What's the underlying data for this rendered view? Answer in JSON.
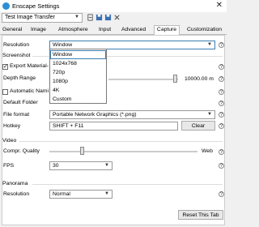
{
  "window": {
    "title": "Enscape Settings",
    "close_glyph": "✕"
  },
  "preset": {
    "value": "Test Image Transfer"
  },
  "tabs": [
    "General",
    "Image",
    "Atmosphere",
    "Input",
    "Advanced",
    "Capture",
    "Customization"
  ],
  "active_tab": "Capture",
  "capture": {
    "resolution_label": "Resolution",
    "resolution_value": "Window",
    "screenshot_label": "Screenshot",
    "export_material_label": "Export Material-",
    "depth_range_label": "Depth Range",
    "depth_range_value": "10000.00 m",
    "automatic_naming_label": "Automatic Nami",
    "default_folder_label": "Default Folder",
    "file_format_label": "File format",
    "file_format_value": "Portable Network Graphics (*.png)",
    "hotkey_label": "Hotkey",
    "hotkey_value": "SHIFT + F11",
    "clear_label": "Clear",
    "video_label": "Video",
    "compr_quality_label": "Compr. Quality",
    "compr_quality_value": "Web",
    "fps_label": "FPS",
    "fps_value": "30",
    "panorama_label": "Panorama",
    "panorama_resolution_label": "Resolution",
    "panorama_resolution_value": "Normal",
    "reset_label": "Reset This Tab"
  },
  "resolution_options": [
    "Window",
    "1024x768",
    "720p",
    "1080p",
    "4K",
    "Custom"
  ],
  "help_glyph": "?"
}
